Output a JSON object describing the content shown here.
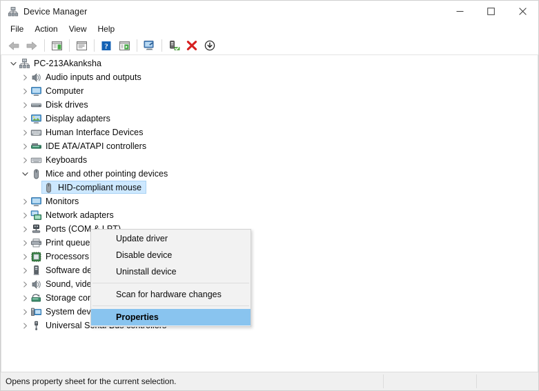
{
  "window": {
    "title": "Device Manager",
    "title_icon": "device-manager-icon",
    "controls": {
      "minimize": "–",
      "maximize": "☐",
      "close": "✕"
    }
  },
  "menubar": {
    "items": [
      {
        "label": "File",
        "name": "menu-file"
      },
      {
        "label": "Action",
        "name": "menu-action"
      },
      {
        "label": "View",
        "name": "menu-view"
      },
      {
        "label": "Help",
        "name": "menu-help"
      }
    ]
  },
  "toolbar": {
    "buttons": [
      {
        "name": "back-icon",
        "tip": "Back"
      },
      {
        "name": "forward-icon",
        "tip": "Forward"
      },
      {
        "name": "separator-1",
        "tip": ""
      },
      {
        "name": "show-hide-console-tree-icon",
        "tip": "Show/Hide Console Tree"
      },
      {
        "name": "separator-2",
        "tip": ""
      },
      {
        "name": "properties-icon",
        "tip": "Properties"
      },
      {
        "name": "separator-3",
        "tip": ""
      },
      {
        "name": "help-icon",
        "tip": "Help"
      },
      {
        "name": "view-details-icon",
        "tip": "View"
      },
      {
        "name": "separator-4",
        "tip": ""
      },
      {
        "name": "scan-hardware-changes-icon",
        "tip": "Scan for hardware changes"
      },
      {
        "name": "separator-5",
        "tip": ""
      },
      {
        "name": "update-driver-icon",
        "tip": "Update driver"
      },
      {
        "name": "uninstall-device-icon",
        "tip": "Uninstall device"
      },
      {
        "name": "disable-device-icon",
        "tip": "Disable device"
      }
    ]
  },
  "tree": {
    "nodes": [
      {
        "label": "PC-213Akanksha",
        "depth": 0,
        "expander": "expanded",
        "icon": "computer-root-icon",
        "selected": false
      },
      {
        "label": "Audio inputs and outputs",
        "depth": 1,
        "expander": "collapsed",
        "icon": "speaker-icon",
        "selected": false
      },
      {
        "label": "Computer",
        "depth": 1,
        "expander": "collapsed",
        "icon": "monitor-icon",
        "selected": false
      },
      {
        "label": "Disk drives",
        "depth": 1,
        "expander": "collapsed",
        "icon": "disk-drive-icon",
        "selected": false
      },
      {
        "label": "Display adapters",
        "depth": 1,
        "expander": "collapsed",
        "icon": "display-adapter-icon",
        "selected": false
      },
      {
        "label": "Human Interface Devices",
        "depth": 1,
        "expander": "collapsed",
        "icon": "keyboard-hid-icon",
        "selected": false
      },
      {
        "label": "IDE ATA/ATAPI controllers",
        "depth": 1,
        "expander": "collapsed",
        "icon": "ide-controller-icon",
        "selected": false
      },
      {
        "label": "Keyboards",
        "depth": 1,
        "expander": "collapsed",
        "icon": "keyboard-icon",
        "selected": false
      },
      {
        "label": "Mice and other pointing devices",
        "depth": 1,
        "expander": "expanded",
        "icon": "mouse-icon",
        "selected": false
      },
      {
        "label": "HID-compliant mouse",
        "depth": 2,
        "expander": "none",
        "icon": "mouse-icon",
        "selected": true
      },
      {
        "label": "Monitors",
        "depth": 1,
        "expander": "collapsed",
        "icon": "monitor-icon",
        "selected": false
      },
      {
        "label": "Network adapters",
        "depth": 1,
        "expander": "collapsed",
        "icon": "network-adapter-icon",
        "selected": false
      },
      {
        "label": "Ports (COM & LPT)",
        "depth": 1,
        "expander": "collapsed",
        "icon": "port-icon",
        "selected": false
      },
      {
        "label": "Print queues",
        "depth": 1,
        "expander": "collapsed",
        "icon": "printer-icon",
        "selected": false
      },
      {
        "label": "Processors",
        "depth": 1,
        "expander": "collapsed",
        "icon": "processor-icon",
        "selected": false
      },
      {
        "label": "Software devices",
        "depth": 1,
        "expander": "collapsed",
        "icon": "software-device-icon",
        "selected": false
      },
      {
        "label": "Sound, video and game controllers",
        "depth": 1,
        "expander": "collapsed",
        "icon": "speaker-icon",
        "selected": false
      },
      {
        "label": "Storage controllers",
        "depth": 1,
        "expander": "collapsed",
        "icon": "storage-controller-icon",
        "selected": false
      },
      {
        "label": "System devices",
        "depth": 1,
        "expander": "collapsed",
        "icon": "system-device-icon",
        "selected": false
      },
      {
        "label": "Universal Serial Bus controllers",
        "depth": 1,
        "expander": "collapsed",
        "icon": "usb-icon",
        "selected": false
      }
    ]
  },
  "context_menu": {
    "items": [
      {
        "label": "Update driver",
        "name": "ctx-update-driver",
        "highlight": false,
        "divider_after": false
      },
      {
        "label": "Disable device",
        "name": "ctx-disable-device",
        "highlight": false,
        "divider_after": false
      },
      {
        "label": "Uninstall device",
        "name": "ctx-uninstall-device",
        "highlight": false,
        "divider_after": true
      },
      {
        "label": "Scan for hardware changes",
        "name": "ctx-scan-hardware",
        "highlight": false,
        "divider_after": true
      },
      {
        "label": "Properties",
        "name": "ctx-properties",
        "highlight": true,
        "divider_after": false
      }
    ]
  },
  "statusbar": {
    "message": "Opens property sheet for the current selection."
  },
  "colors": {
    "selection_fill": "#cde8ff",
    "selection_border": "#a9d2f3",
    "menu_highlight": "#89c4ef",
    "menu_bg": "#f2f2f2",
    "status_bg": "#f0f0f0"
  }
}
